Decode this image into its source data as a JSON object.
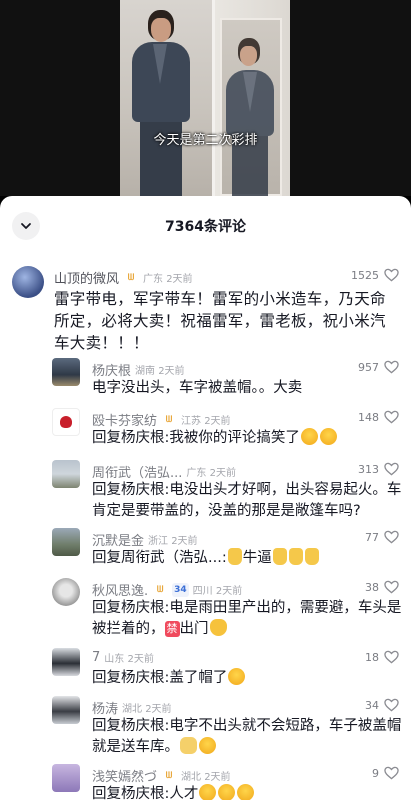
{
  "video": {
    "subtitle": "今天是第二次彩排"
  },
  "sheet": {
    "title": "7364条评论"
  },
  "comments": [
    {
      "name": "山顶的微风",
      "badge": "ᗯ",
      "location": "广东 2天前",
      "text": "雷字带电，军字带车！雷军的小米造车，乃天命所定，必将大卖！祝福雷军，雷老板，祝小米汽车大卖！！！",
      "likes": "1525"
    },
    {
      "name": "杨庆根",
      "location": "湖南 2天前",
      "text": "电字没出头，车字被盖帽。。大卖",
      "likes": "957"
    },
    {
      "name": "殴卡芬家纺",
      "badge": "ᗯ",
      "location": "江苏 2天前",
      "text": "回复杨庆根:我被你的评论搞笑了",
      "likes": "148"
    },
    {
      "name": "周衔武（浩弘...",
      "location": "广东 2天前",
      "text": "回复杨庆根:电没出头才好啊，出头容易起火。车肯定是要带盖的，没盖的那是是敞篷车吗?",
      "likes": "313"
    },
    {
      "name": "沉默是金",
      "location": "浙江 2天前",
      "text_prefix": "回复周衔武（浩弘...:",
      "text_mid": "牛逼",
      "likes": "77"
    },
    {
      "name": "秋风思逸.",
      "badge": "ᗯ",
      "badge2": "34",
      "location": "四川 2天前",
      "text_a": "回复杨庆根:电是雨田里产出的，需要避，车头是被拦着的，",
      "ban": "禁",
      "text_b": "出门",
      "likes": "38"
    },
    {
      "name": "7",
      "location": "山东 2天前",
      "text": "回复杨庆根:盖了帽了",
      "likes": "18"
    },
    {
      "name": "杨涛",
      "location": "湖北 2天前",
      "text": "回复杨庆根:电字不出头就不会短路，车子被盖帽就是送车库。",
      "likes": "34"
    },
    {
      "name": "浅笑嫣然づ",
      "badge": "ᗯ",
      "location": "湖北 2天前",
      "text": "回复杨庆根:人才",
      "likes": "9"
    }
  ]
}
